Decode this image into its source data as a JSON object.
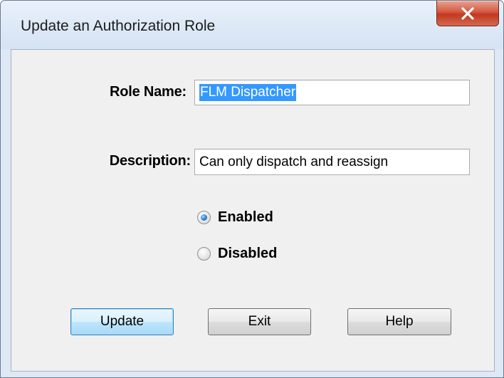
{
  "window": {
    "title": "Update an Authorization Role"
  },
  "form": {
    "role_name_label": "Role Name:",
    "role_name_value": "FLM Dispatcher",
    "description_label": "Description:",
    "description_value": "Can only dispatch and reassign",
    "status_options": [
      {
        "label": "Enabled",
        "selected": true
      },
      {
        "label": "Disabled",
        "selected": false
      }
    ]
  },
  "buttons": {
    "update_label": "Update",
    "exit_label": "Exit",
    "help_label": "Help"
  },
  "icons": {
    "close": "close-icon"
  },
  "colors": {
    "selection": "#3399ff",
    "close_button": "#c0391f",
    "default_button_border": "#3c7fb1"
  }
}
